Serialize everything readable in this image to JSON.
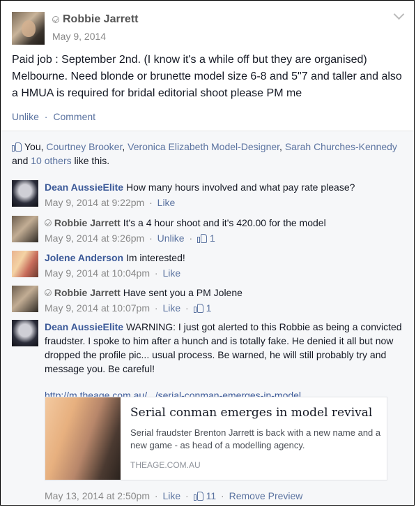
{
  "post": {
    "author": "Robbie Jarrett",
    "date": "May 9, 2014",
    "text": "Paid job : September 2nd. (I know it's a while off but they are organised) Melbourne. Need blonde or brunette model size 6-8 and 5\"7 and taller and also a HMUA is required for bridal editorial shoot please PM me",
    "unlike": "Unlike",
    "comment": "Comment",
    "dot": "·"
  },
  "likes": {
    "prefix": "You, ",
    "names": [
      "Courtney Brooker",
      "Veronica Elizabeth Model-Designer",
      "Sarah Churches-Kennedy"
    ],
    "sep": ", ",
    "and": " and ",
    "others": "10 others",
    "suffix": " like this."
  },
  "comments": [
    {
      "name": "Dean AussieElite",
      "text": "How many hours involved and what pay rate please?",
      "time": "May 9, 2014 at 9:22pm",
      "action": "Like",
      "likes": ""
    },
    {
      "name": "Robbie Jarrett",
      "text": "It's a 4 hour shoot and it's 420.00 for the model",
      "time": "May 9, 2014 at 9:26pm",
      "action": "Unlike",
      "likes": "1"
    },
    {
      "name": "Jolene Anderson",
      "text": "Im interested!",
      "time": "May 9, 2014 at 10:04pm",
      "action": "Like",
      "likes": ""
    },
    {
      "name": "Robbie Jarrett",
      "text": "Have sent you a PM Jolene",
      "time": "May 9, 2014 at 10:07pm",
      "action": "Like",
      "likes": "1"
    },
    {
      "name": "Dean AussieElite",
      "text": "WARNING: I just got alerted to this Robbie as being a convicted fraudster. I spoke to him after a hunch and is totally fake. He denied it all but now dropped the profile pic... usual process. Be warned, he will still probably try and message you. Be careful!",
      "url": "http://m.theage.com.au/.../serial-conman-emerges-in-model...",
      "time": "May 13, 2014 at 2:50pm",
      "action": "Like",
      "likes": "11",
      "remove": "Remove Preview"
    }
  ],
  "preview": {
    "title": "Serial conman emerges in model revival",
    "desc": "Serial fraudster Brenton Jarrett is back with a new name and a new game - as head of a modelling agency.",
    "source": "THEAGE.COM.AU"
  },
  "sep": "·"
}
